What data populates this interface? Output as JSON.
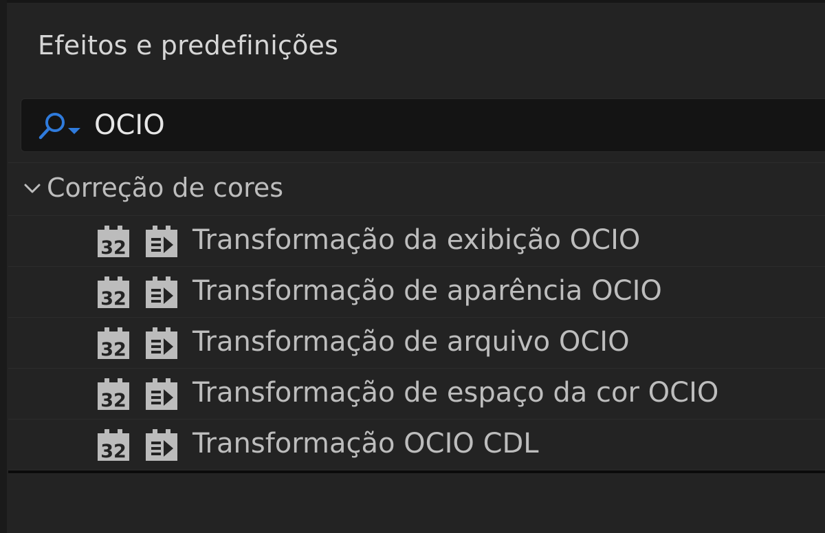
{
  "panel": {
    "title": "Efeitos e predefinições"
  },
  "search": {
    "value": "OCIO",
    "icon": "search-dropdown-icon",
    "accent_color": "#2f7bdc"
  },
  "tree": {
    "category": {
      "label": "Correção de cores",
      "expanded": true,
      "icon": "chevron-down-icon"
    },
    "effects": [
      {
        "label": "Transformação da exibição OCIO",
        "badge_32": "32"
      },
      {
        "label": "Transformação de aparência OCIO",
        "badge_32": "32"
      },
      {
        "label": "Transformação de arquivo OCIO",
        "badge_32": "32"
      },
      {
        "label": "Transformação de espaço da cor OCIO",
        "badge_32": "32"
      },
      {
        "label": "Transformação OCIO CDL",
        "badge_32": "32"
      }
    ]
  }
}
